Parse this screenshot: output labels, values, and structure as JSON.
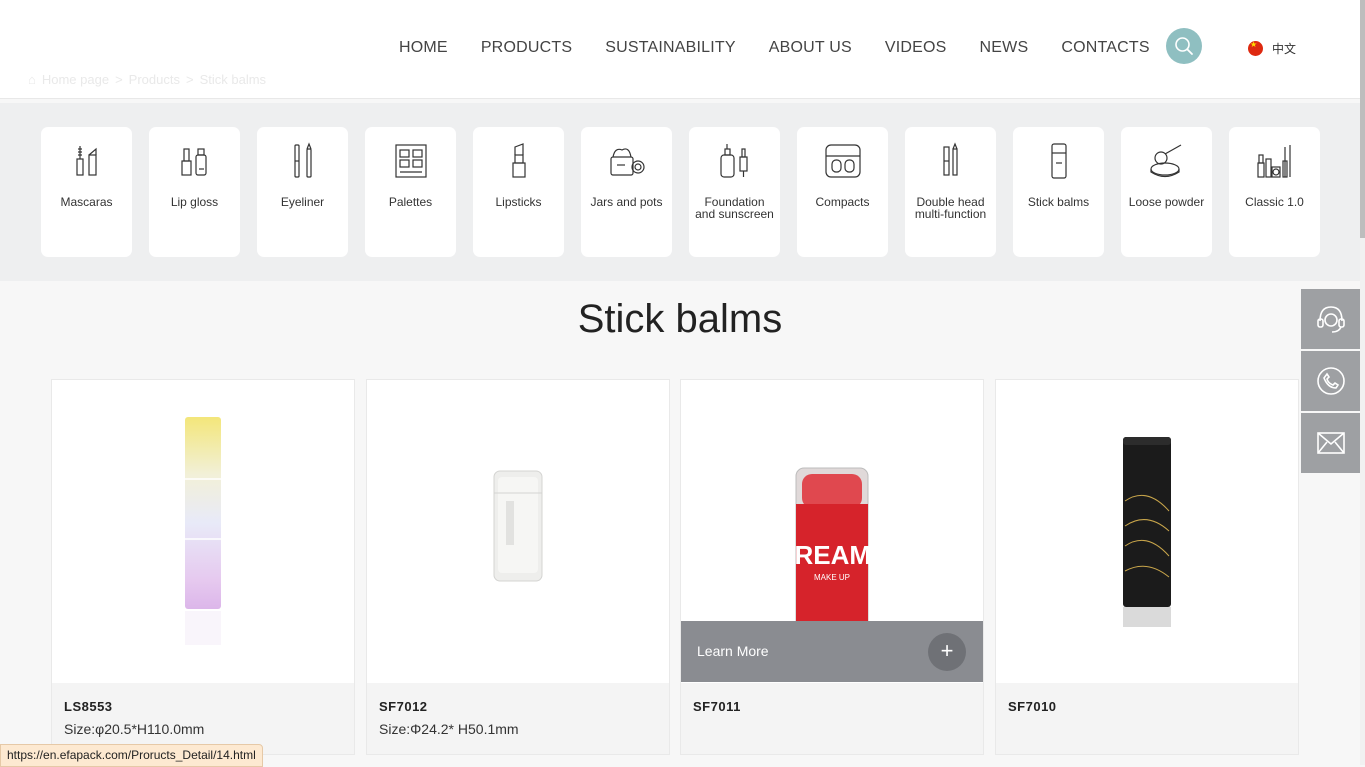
{
  "nav": {
    "items": [
      "HOME",
      "PRODUCTS",
      "SUSTAINABILITY",
      "ABOUT US",
      "VIDEOS",
      "NEWS",
      "CONTACTS"
    ],
    "language": "中文"
  },
  "breadcrumb": {
    "home": "Home page",
    "sep1": ">",
    "products": "Products",
    "sep2": ">",
    "current": "Stick balms"
  },
  "categories": [
    {
      "label": "Mascaras",
      "icon": "mascara-icon"
    },
    {
      "label": "Lip gloss",
      "icon": "lip-gloss-icon"
    },
    {
      "label": "Eyeliner",
      "icon": "eyeliner-icon"
    },
    {
      "label": "Palettes",
      "icon": "palette-icon"
    },
    {
      "label": "Lipsticks",
      "icon": "lipstick-icon"
    },
    {
      "label": "Jars and pots",
      "icon": "jar-icon"
    },
    {
      "label": "Foundation and sunscreen",
      "icon": "foundation-bottle-icon"
    },
    {
      "label": "Compacts",
      "icon": "compact-icon"
    },
    {
      "label": "Double head multi-function",
      "icon": "double-head-icon"
    },
    {
      "label": "Stick balms",
      "icon": "stick-balm-icon"
    },
    {
      "label": "Loose powder",
      "icon": "loose-powder-icon"
    },
    {
      "label": "Classic 1.0",
      "icon": "classic-set-icon"
    }
  ],
  "section_title": "Stick balms",
  "products": [
    {
      "code": "LS8553",
      "size": "Size:φ20.5*H110.0mm"
    },
    {
      "code": "SF7012",
      "size": "Size:Φ24.2* H50.1mm"
    },
    {
      "code": "SF7011",
      "size": "",
      "hover_label": "Learn More",
      "product_print": "CREAMY",
      "product_subprint": "MAKE UP"
    },
    {
      "code": "SF7010",
      "size": ""
    }
  ],
  "side_buttons": [
    "customer-service-icon",
    "phone-icon",
    "mail-icon"
  ],
  "status_url": "https://en.efapack.com/Proructs_Detail/14.html",
  "colors": {
    "search_bg": "#8fbfc1",
    "side_bg": "#9ea0a3",
    "learn_bg": "#8a8c91"
  }
}
